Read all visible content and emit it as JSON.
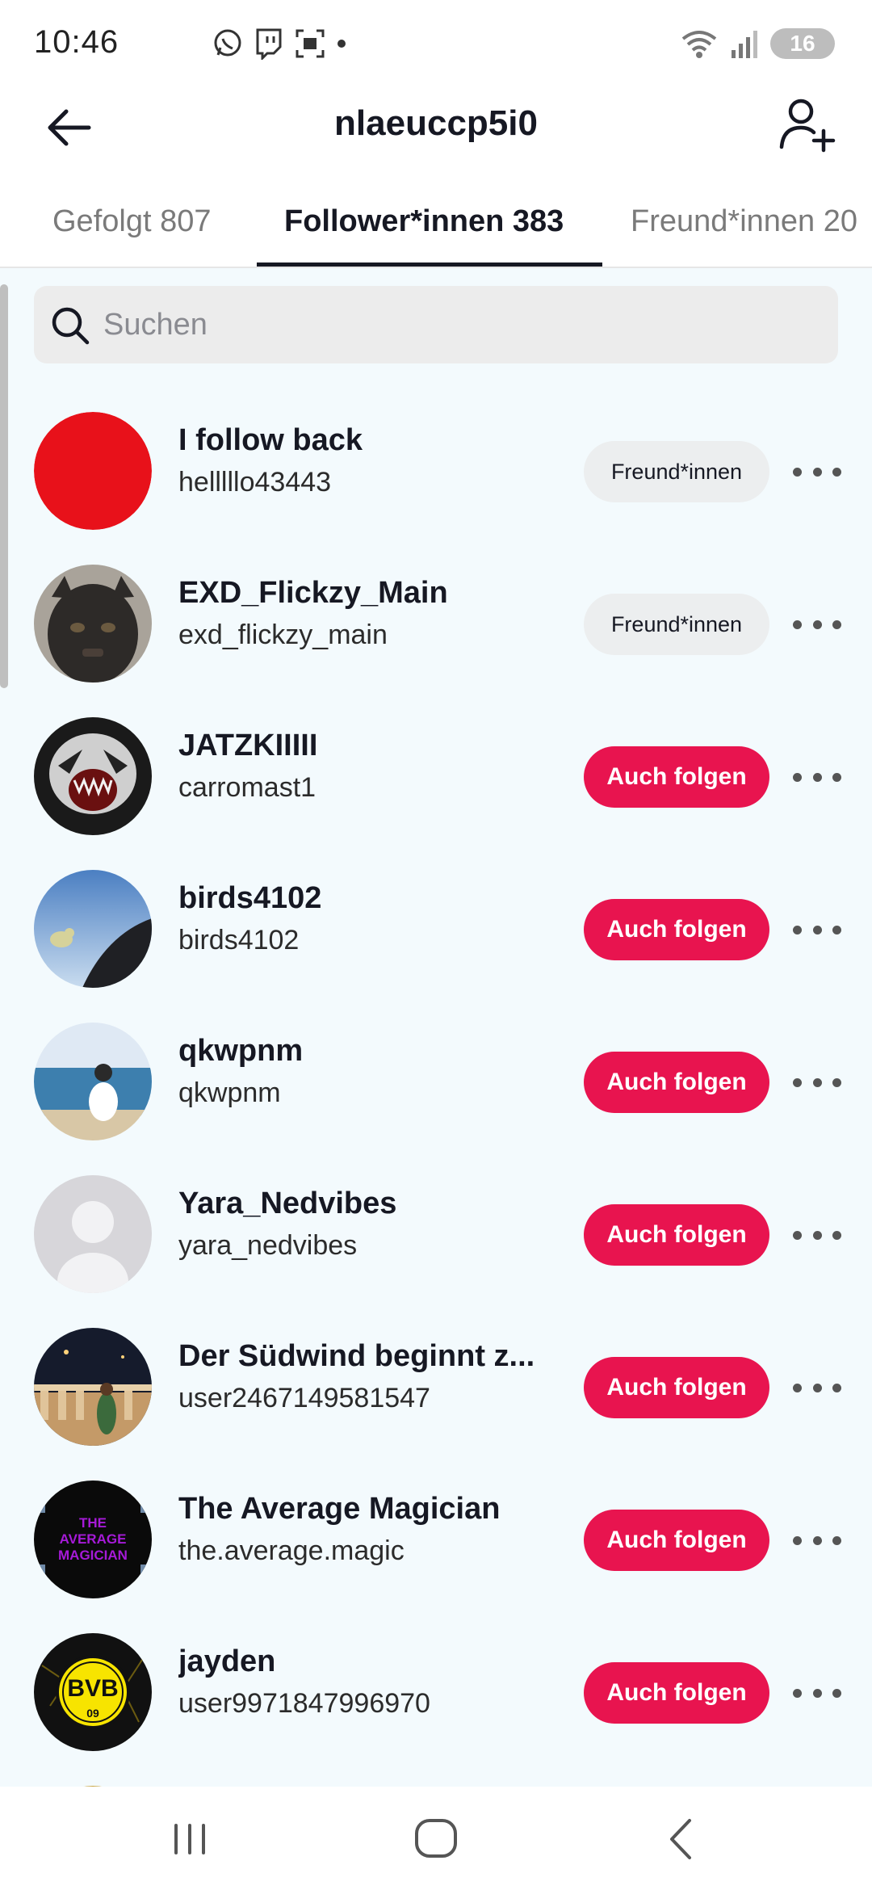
{
  "status_bar": {
    "time": "10:46",
    "left_icons": [
      "whatsapp-icon",
      "twitch-icon",
      "screenshot-icon",
      "dot-icon"
    ],
    "right_icons": [
      "wifi-icon",
      "signal-icon"
    ],
    "battery_level": "16"
  },
  "header": {
    "title": "nlaeuccp5i0",
    "back_icon": "arrow-left-icon",
    "add_user_icon": "add-user-icon"
  },
  "tabs": [
    {
      "label": "Gefolgt 807",
      "active": false
    },
    {
      "label": "Follower*innen 383",
      "active": true
    },
    {
      "label": "Freund*innen 20",
      "active": false
    }
  ],
  "search": {
    "placeholder": "Suchen"
  },
  "users": [
    {
      "display_name": "I follow back",
      "username": "helllllo43443",
      "button": "Freund*innen",
      "button_type": "friend",
      "avatar": "red-circle"
    },
    {
      "display_name": "EXD_Flickzy_Main",
      "username": "exd_flickzy_main",
      "button": "Freund*innen",
      "button_type": "friend",
      "avatar": "black-cat"
    },
    {
      "display_name": "JATZKIIIII",
      "username": "carromast1",
      "button": "Auch folgen",
      "button_type": "follow",
      "avatar": "tiger"
    },
    {
      "display_name": "birds4102",
      "username": "birds4102",
      "button": "Auch folgen",
      "button_type": "follow",
      "avatar": "bird-sky"
    },
    {
      "display_name": "qkwpnm",
      "username": "qkwpnm",
      "button": "Auch folgen",
      "button_type": "follow",
      "avatar": "sea-girl"
    },
    {
      "display_name": "Yara_Nedvibes",
      "username": "yara_nedvibes",
      "button": "Auch folgen",
      "button_type": "follow",
      "avatar": "default-person"
    },
    {
      "display_name": "Der Südwind beginnt z...",
      "username": "user2467149581547",
      "button": "Auch folgen",
      "button_type": "follow",
      "avatar": "night-balcony"
    },
    {
      "display_name": "The Average Magician",
      "username": "the.average.magic",
      "button": "Auch folgen",
      "button_type": "follow",
      "avatar": "magician-text",
      "avatar_text": "THE AVERAGE MAGICIAN"
    },
    {
      "display_name": "jayden",
      "username": "user9971847996970",
      "button": "Auch folgen",
      "button_type": "follow",
      "avatar": "bvb-logo",
      "avatar_text": "BVB 09"
    }
  ],
  "colors": {
    "follow_button": "#e8144f",
    "friend_button": "#eceeef",
    "list_background": "#f3fafd"
  },
  "nav_bar": {
    "icons": [
      "recent-apps-icon",
      "home-icon",
      "back-icon"
    ]
  }
}
